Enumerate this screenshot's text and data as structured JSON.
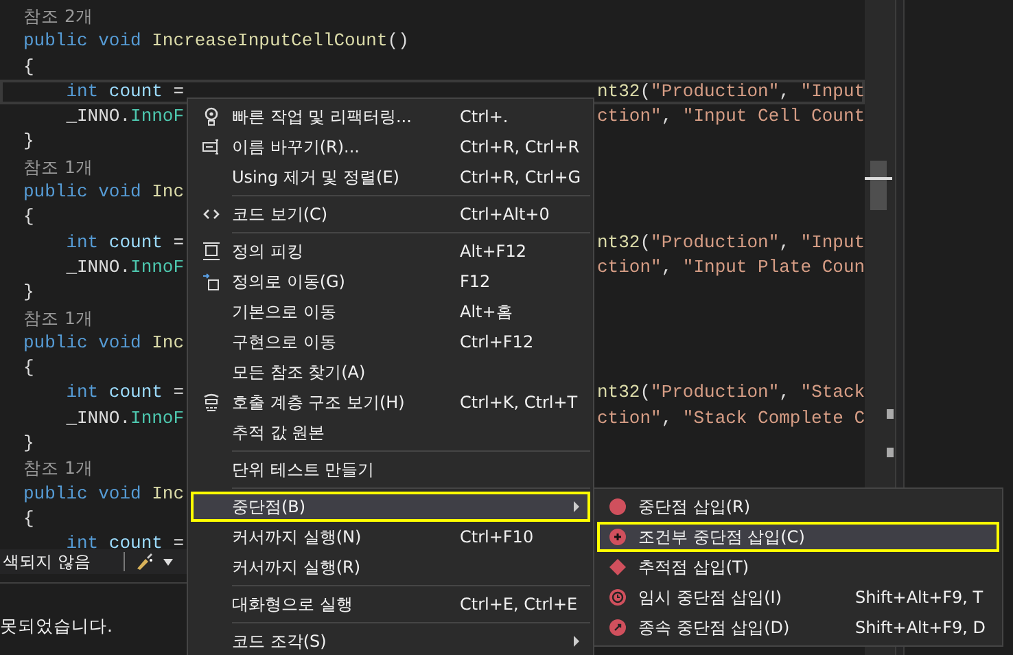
{
  "editor": {
    "lines": [
      {
        "kind": "lens",
        "text": "참조 2개"
      },
      {
        "kind": "code",
        "current": false,
        "left": [
          {
            "kind": "kw",
            "s": "public void "
          },
          {
            "kind": "fn",
            "s": "IncreaseInputCellCount"
          },
          {
            "kind": "pl",
            "s": "()"
          }
        ]
      },
      {
        "kind": "code",
        "current": false,
        "left": [
          {
            "kind": "pl",
            "s": "{"
          }
        ]
      },
      {
        "kind": "code",
        "current": true,
        "left": [
          {
            "kind": "kw",
            "s": "    int "
          },
          {
            "kind": "id",
            "s": "count"
          },
          {
            "kind": "pl",
            "s": " ="
          }
        ],
        "right": [
          {
            "kind": "fn",
            "s": "nt32"
          },
          {
            "kind": "pl",
            "s": "("
          },
          {
            "kind": "st",
            "s": "\"Production\""
          },
          {
            "kind": "pl",
            "s": ", "
          },
          {
            "kind": "st",
            "s": "\"Input"
          }
        ]
      },
      {
        "kind": "code",
        "current": false,
        "left": [
          {
            "kind": "pl",
            "s": "    _INNO."
          },
          {
            "kind": "ty",
            "s": "InnoF"
          }
        ],
        "right": [
          {
            "kind": "st",
            "s": "ction\""
          },
          {
            "kind": "pl",
            "s": ", "
          },
          {
            "kind": "st",
            "s": "\"Input Cell Count"
          }
        ]
      },
      {
        "kind": "code",
        "current": false,
        "left": [
          {
            "kind": "pl",
            "s": "}"
          }
        ]
      },
      {
        "kind": "lens",
        "text": "참조 1개"
      },
      {
        "kind": "code",
        "current": false,
        "left": [
          {
            "kind": "kw",
            "s": "public void "
          },
          {
            "kind": "fn",
            "s": "Inc"
          }
        ]
      },
      {
        "kind": "code",
        "current": false,
        "left": [
          {
            "kind": "pl",
            "s": "{"
          }
        ]
      },
      {
        "kind": "code",
        "current": false,
        "left": [
          {
            "kind": "kw",
            "s": "    int "
          },
          {
            "kind": "id",
            "s": "count"
          },
          {
            "kind": "pl",
            "s": " ="
          }
        ],
        "right": [
          {
            "kind": "fn",
            "s": "nt32"
          },
          {
            "kind": "pl",
            "s": "("
          },
          {
            "kind": "st",
            "s": "\"Production\""
          },
          {
            "kind": "pl",
            "s": ", "
          },
          {
            "kind": "st",
            "s": "\"Input"
          }
        ]
      },
      {
        "kind": "code",
        "current": false,
        "left": [
          {
            "kind": "pl",
            "s": "    _INNO."
          },
          {
            "kind": "ty",
            "s": "InnoF"
          }
        ],
        "right": [
          {
            "kind": "st",
            "s": "ction\""
          },
          {
            "kind": "pl",
            "s": ", "
          },
          {
            "kind": "st",
            "s": "\"Input Plate Coun"
          }
        ]
      },
      {
        "kind": "code",
        "current": false,
        "left": [
          {
            "kind": "pl",
            "s": "}"
          }
        ]
      },
      {
        "kind": "lens",
        "text": "참조 1개"
      },
      {
        "kind": "code",
        "current": false,
        "left": [
          {
            "kind": "kw",
            "s": "public void "
          },
          {
            "kind": "fn",
            "s": "Inc"
          }
        ]
      },
      {
        "kind": "code",
        "current": false,
        "left": [
          {
            "kind": "pl",
            "s": "{"
          }
        ]
      },
      {
        "kind": "code",
        "current": false,
        "left": [
          {
            "kind": "kw",
            "s": "    int "
          },
          {
            "kind": "id",
            "s": "count"
          },
          {
            "kind": "pl",
            "s": " ="
          }
        ],
        "right": [
          {
            "kind": "fn",
            "s": "nt32"
          },
          {
            "kind": "pl",
            "s": "("
          },
          {
            "kind": "st",
            "s": "\"Production\""
          },
          {
            "kind": "pl",
            "s": ", "
          },
          {
            "kind": "st",
            "s": "\"Stack"
          }
        ]
      },
      {
        "kind": "code",
        "current": false,
        "left": [
          {
            "kind": "pl",
            "s": "    _INNO."
          },
          {
            "kind": "ty",
            "s": "InnoF"
          }
        ],
        "right": [
          {
            "kind": "st",
            "s": "ction\""
          },
          {
            "kind": "pl",
            "s": ", "
          },
          {
            "kind": "st",
            "s": "\"Stack Complete C"
          }
        ]
      },
      {
        "kind": "code",
        "current": false,
        "left": [
          {
            "kind": "pl",
            "s": "}"
          }
        ]
      },
      {
        "kind": "lens",
        "text": "참조 1개"
      },
      {
        "kind": "code",
        "current": false,
        "left": [
          {
            "kind": "kw",
            "s": "public void "
          },
          {
            "kind": "fn",
            "s": "Inc"
          }
        ]
      },
      {
        "kind": "code",
        "current": false,
        "left": [
          {
            "kind": "pl",
            "s": "{"
          }
        ]
      },
      {
        "kind": "code",
        "current": false,
        "left": [
          {
            "kind": "kw",
            "s": "    int "
          },
          {
            "kind": "id",
            "s": "count"
          },
          {
            "kind": "pl",
            "s": " ="
          }
        ]
      }
    ]
  },
  "status_bar": {
    "text": "색되지 않음"
  },
  "output": {
    "text": "못되었습니다."
  },
  "context_menu": {
    "items": [
      {
        "kind": "item",
        "label": "빠른 작업 및 리팩터링...",
        "shortcut": "Ctrl+.",
        "submenu": false,
        "selected": false,
        "outlined": false
      },
      {
        "kind": "item",
        "label": "이름 바꾸기(R)...",
        "shortcut": "Ctrl+R, Ctrl+R",
        "submenu": false,
        "selected": false,
        "outlined": false
      },
      {
        "kind": "item",
        "label": "Using 제거 및 정렬(E)",
        "shortcut": "Ctrl+R, Ctrl+G",
        "submenu": false,
        "selected": false,
        "outlined": false
      },
      {
        "kind": "separator"
      },
      {
        "kind": "item",
        "label": "코드 보기(C)",
        "shortcut": "Ctrl+Alt+0",
        "submenu": false,
        "selected": false,
        "outlined": false
      },
      {
        "kind": "separator"
      },
      {
        "kind": "item",
        "label": "정의 피킹",
        "shortcut": "Alt+F12",
        "submenu": false,
        "selected": false,
        "outlined": false
      },
      {
        "kind": "item",
        "label": "정의로 이동(G)",
        "shortcut": "F12",
        "submenu": false,
        "selected": false,
        "outlined": false
      },
      {
        "kind": "item",
        "label": "기본으로 이동",
        "shortcut": "Alt+홈",
        "submenu": false,
        "selected": false,
        "outlined": false
      },
      {
        "kind": "item",
        "label": "구현으로 이동",
        "shortcut": "Ctrl+F12",
        "submenu": false,
        "selected": false,
        "outlined": false
      },
      {
        "kind": "item",
        "label": "모든 참조 찾기(A)",
        "submenu": false,
        "selected": false,
        "outlined": false
      },
      {
        "kind": "item",
        "label": "호출 계층 구조 보기(H)",
        "shortcut": "Ctrl+K, Ctrl+T",
        "submenu": false,
        "selected": false,
        "outlined": false
      },
      {
        "kind": "item",
        "label": "추적 값 원본",
        "submenu": false,
        "selected": false,
        "outlined": false
      },
      {
        "kind": "separator"
      },
      {
        "kind": "item",
        "label": "단위 테스트 만들기",
        "submenu": false,
        "selected": false,
        "outlined": false
      },
      {
        "kind": "separator"
      },
      {
        "kind": "item",
        "label": "중단점(B)",
        "submenu": true,
        "selected": true,
        "outlined": true
      },
      {
        "kind": "item",
        "label": "커서까지 실행(N)",
        "shortcut": "Ctrl+F10",
        "submenu": false,
        "selected": false,
        "outlined": false
      },
      {
        "kind": "item",
        "label": "커서까지 실행(R)",
        "submenu": false,
        "selected": false,
        "outlined": false
      },
      {
        "kind": "separator"
      },
      {
        "kind": "item",
        "label": "대화형으로 실행",
        "shortcut": "Ctrl+E, Ctrl+E",
        "submenu": false,
        "selected": false,
        "outlined": false
      },
      {
        "kind": "separator"
      },
      {
        "kind": "item",
        "label": "코드 조각(S)",
        "submenu": true,
        "selected": false,
        "outlined": false
      }
    ]
  },
  "submenu": {
    "items": [
      {
        "label": "중단점 삽입(R)",
        "selected": false,
        "outlined": false
      },
      {
        "label": "조건부 중단점 삽입(C)",
        "selected": true,
        "outlined": true
      },
      {
        "label": "추적점 삽입(T)",
        "selected": false,
        "outlined": false
      },
      {
        "label": "임시 중단점 삽입(I)",
        "shortcut": "Shift+Alt+F9, T",
        "selected": false,
        "outlined": false
      },
      {
        "label": "종속 중단점 삽입(D)",
        "shortcut": "Shift+Alt+F9, D",
        "selected": false,
        "outlined": false
      }
    ]
  }
}
